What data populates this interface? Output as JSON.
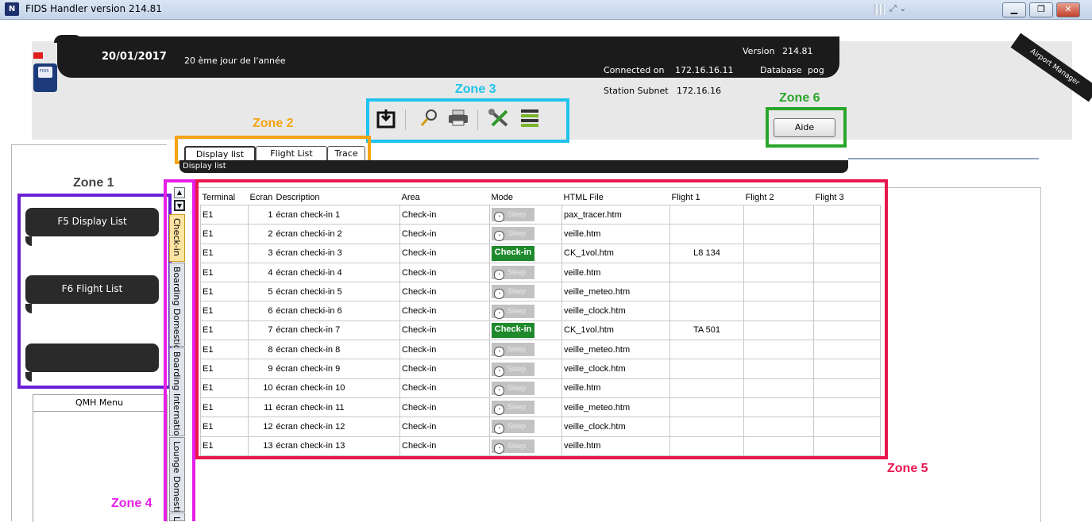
{
  "window": {
    "title": "FIDS Handler  version 214.81",
    "controls": [
      "minimize",
      "restore",
      "close"
    ],
    "app_icon_text": "N"
  },
  "header": {
    "date": "20/01/2017",
    "day_of_year": "20 ème jour de l'année",
    "version_label": "Version",
    "version_value": "214.81",
    "connected_label": "Connected on",
    "connected_value": "172.16.16.11",
    "database_label": "Database",
    "database_value": "pog",
    "subnet_label": "Station Subnet",
    "subnet_value": "172.16.16",
    "ribbon": "Airport Manager",
    "logo_text": "FIDS"
  },
  "zones": {
    "z1": "Zone 1",
    "z2": "Zone 2",
    "z3": "Zone 3",
    "z4": "Zone 4",
    "z5": "Zone 5",
    "z6": "Zone 6"
  },
  "toolbar": {
    "icons": [
      "import-icon",
      "search-icon",
      "print-icon",
      "tools-icon",
      "list-icon"
    ]
  },
  "help_button": "Aide",
  "tabs": [
    "Display list",
    "Flight List",
    "Trace"
  ],
  "strip_title": "Display list",
  "nav": {
    "display_list": "F5  Display List",
    "flight_list": "F6 Flight List",
    "empty": ""
  },
  "qmh_menu": "QMH Menu",
  "vertical_tabs": [
    "Check-in",
    "Boarding Domestic",
    "Boarding Internatio",
    "Lounge Domestic",
    "L"
  ],
  "table": {
    "columns": [
      "Terminal",
      "Ecran",
      "Description",
      "Area",
      "Mode",
      "HTML File",
      "Flight 1",
      "Flight 2",
      "Flight 3"
    ],
    "rows": [
      {
        "terminal": "E1",
        "ecran": "1",
        "description": "écran check-in 1",
        "area": "Check-in",
        "mode": "Sleep",
        "html": "pax_tracer.htm",
        "f1": "",
        "f2": "",
        "f3": ""
      },
      {
        "terminal": "E1",
        "ecran": "2",
        "description": "écran checki-in 2",
        "area": "Check-in",
        "mode": "Sleep",
        "html": "veille.htm",
        "f1": "",
        "f2": "",
        "f3": ""
      },
      {
        "terminal": "E1",
        "ecran": "3",
        "description": "écran checki-in 3",
        "area": "Check-in",
        "mode": "Check-in",
        "html": "CK_1vol.htm",
        "f1": "L8 134",
        "f2": "",
        "f3": ""
      },
      {
        "terminal": "E1",
        "ecran": "4",
        "description": "écran checki-in 4",
        "area": "Check-in",
        "mode": "Sleep",
        "html": "veille.htm",
        "f1": "",
        "f2": "",
        "f3": ""
      },
      {
        "terminal": "E1",
        "ecran": "5",
        "description": "écran checki-in 5",
        "area": "Check-in",
        "mode": "Sleep",
        "html": "veille_meteo.htm",
        "f1": "",
        "f2": "",
        "f3": ""
      },
      {
        "terminal": "E1",
        "ecran": "6",
        "description": "écran checki-in 6",
        "area": "Check-in",
        "mode": "Sleep",
        "html": "veille_clock.htm",
        "f1": "",
        "f2": "",
        "f3": ""
      },
      {
        "terminal": "E1",
        "ecran": "7",
        "description": "écran check-in 7",
        "area": "Check-in",
        "mode": "Check-in",
        "html": "CK_1vol.htm",
        "f1": "TA 501",
        "f2": "",
        "f3": ""
      },
      {
        "terminal": "E1",
        "ecran": "8",
        "description": "écran check-in 8",
        "area": "Check-in",
        "mode": "Sleep",
        "html": "veille_meteo.htm",
        "f1": "",
        "f2": "",
        "f3": ""
      },
      {
        "terminal": "E1",
        "ecran": "9",
        "description": "écran check-in 9",
        "area": "Check-in",
        "mode": "Sleep",
        "html": "veille_clock.htm",
        "f1": "",
        "f2": "",
        "f3": ""
      },
      {
        "terminal": "E1",
        "ecran": "10",
        "description": "écran check-in 10",
        "area": "Check-in",
        "mode": "Sleep",
        "html": "veille.htm",
        "f1": "",
        "f2": "",
        "f3": ""
      },
      {
        "terminal": "E1",
        "ecran": "11",
        "description": "écran check-in 11",
        "area": "Check-in",
        "mode": "Sleep",
        "html": "veille_meteo.htm",
        "f1": "",
        "f2": "",
        "f3": ""
      },
      {
        "terminal": "E1",
        "ecran": "12",
        "description": "écran check-in 12",
        "area": "Check-in",
        "mode": "Sleep",
        "html": "veille_clock.htm",
        "f1": "",
        "f2": "",
        "f3": ""
      },
      {
        "terminal": "E1",
        "ecran": "13",
        "description": "écran check-in 13",
        "area": "Check-in",
        "mode": "Sleep",
        "html": "veille.htm",
        "f1": "",
        "f2": "",
        "f3": ""
      }
    ]
  },
  "colors": {
    "zone1": "#6a1fd6",
    "zone2": "#f5a414",
    "zone3": "#1ec3ee",
    "zone4": "#e61fe6",
    "zone5": "#e8164d",
    "zone6": "#2aa62a",
    "checkin_green": "#1f8a2c"
  }
}
